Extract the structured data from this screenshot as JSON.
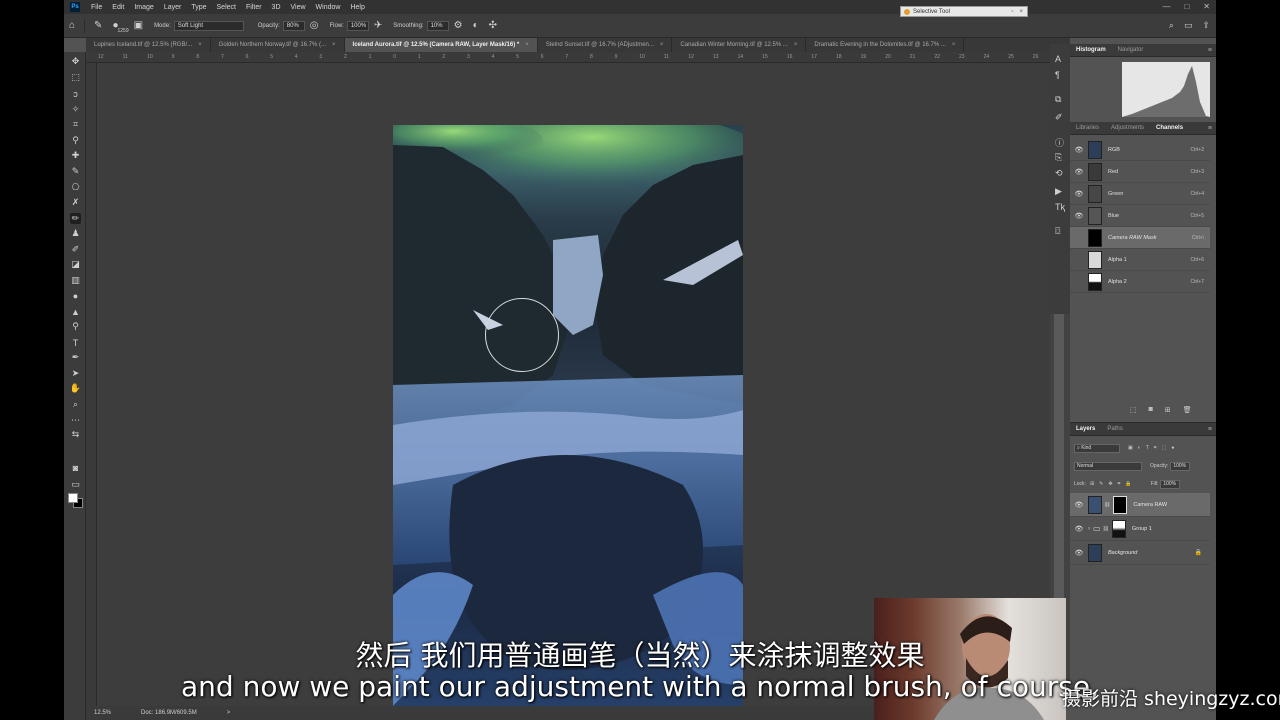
{
  "menubar": {
    "logo": "Ps",
    "items": [
      "File",
      "Edit",
      "Image",
      "Layer",
      "Type",
      "Select",
      "Filter",
      "3D",
      "View",
      "Window",
      "Help"
    ],
    "window_controls": [
      "—",
      "□",
      "✕"
    ]
  },
  "selective_tool": {
    "title": "Selective Tool"
  },
  "options": {
    "brush_size": "1259",
    "mode_label": "Mode:",
    "mode_value": "Soft Light",
    "opacity_label": "Opacity:",
    "opacity_value": "80%",
    "flow_label": "Flow:",
    "flow_value": "100%",
    "smoothing_label": "Smoothing:",
    "smoothing_value": "10%"
  },
  "tabs": [
    {
      "label": "Lupines Iceland.tif @ 12.5% (RGB/..."
    },
    {
      "label": "Golden Northern Norway.tif @ 16.7% (..."
    },
    {
      "label": "Iceland Aurora.tif @ 12.5% (Camera RAW, Layer Mask/16) *"
    },
    {
      "label": "Stelnd Sunset.tif @ 16.7% (ADjustmen..."
    },
    {
      "label": "Canadian Winter Morning.tif @ 12.5% ..."
    },
    {
      "label": "Dramatic Evening in the Dolomites.tif @ 16.7% ..."
    }
  ],
  "tab_close": "×",
  "ruler_ticks": [
    "12",
    "11",
    "10",
    "9",
    "8",
    "7",
    "6",
    "5",
    "4",
    "3",
    "2",
    "1",
    "0",
    "1",
    "2",
    "3",
    "4",
    "5",
    "6",
    "7",
    "8",
    "9",
    "10",
    "11",
    "12",
    "13",
    "14",
    "15",
    "16",
    "17",
    "18",
    "19",
    "20",
    "21",
    "22",
    "23",
    "24",
    "25",
    "26"
  ],
  "histogram_panel": {
    "tabs": [
      "Histogram",
      "Navigator"
    ],
    "menu": "≡"
  },
  "channels_panel": {
    "tabs": [
      "Libraries",
      "Adjustments",
      "Channels"
    ],
    "menu": "≡",
    "rows": [
      {
        "name": "RGB",
        "key": "Ctrl+2",
        "eye": "👁"
      },
      {
        "name": "Red",
        "key": "Ctrl+3",
        "eye": "👁"
      },
      {
        "name": "Green",
        "key": "Ctrl+4",
        "eye": "👁"
      },
      {
        "name": "Blue",
        "key": "Ctrl+5",
        "eye": "👁"
      },
      {
        "name": "Camera RAW Mask",
        "key": "Ctrl+\\",
        "eye": ""
      },
      {
        "name": "Alpha 1",
        "key": "Ctrl+6",
        "eye": ""
      },
      {
        "name": "Alpha 2",
        "key": "Ctrl+7",
        "eye": ""
      }
    ]
  },
  "layers_panel": {
    "tabs": [
      "Layers",
      "Paths"
    ],
    "menu": "≡",
    "kind_label": "Kind",
    "blend_mode": "Normal",
    "opacity_label": "Opacity:",
    "opacity_value": "100%",
    "lock_label": "Lock:",
    "fill_label": "Fill:",
    "fill_value": "100%",
    "rows": [
      {
        "name": "Camera RAW"
      },
      {
        "name": "Group 1"
      },
      {
        "name": "Background"
      }
    ]
  },
  "status": {
    "zoom": "12.5%",
    "doc": "Doc: 186.9M/609.5M",
    "arrow": ">"
  },
  "subtitles": {
    "cn": "然后 我们用普通画笔（当然）来涂抹调整效果",
    "en": "and now we paint our adjustment with a normal brush, of course,"
  },
  "watermark": "摄影前沿 sheyingzyz.com",
  "colors": {
    "accent": "#31a8ff",
    "panel_bg": "#535353",
    "chrome_bg": "#3c3c3c"
  }
}
